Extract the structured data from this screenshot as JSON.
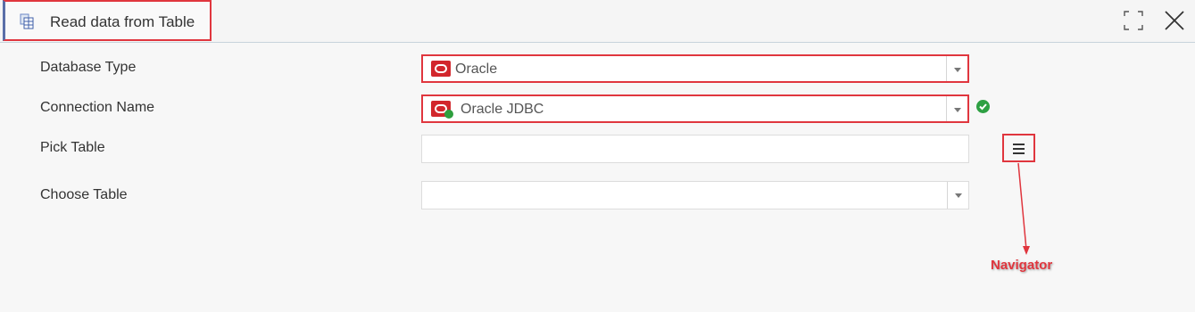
{
  "window": {
    "tab_title": "Read data from Table",
    "tab_icon": "table-icon",
    "expand_icon": "expand-icon",
    "close_icon": "close-icon"
  },
  "form": {
    "database_type": {
      "label": "Database Type",
      "value": "Oracle",
      "icon": "oracle-logo-icon"
    },
    "connection_name": {
      "label": "Connection Name",
      "value": "Oracle JDBC",
      "icon": "oracle-connection-icon",
      "status_icon": "check-circle-icon"
    },
    "pick_table": {
      "label": "Pick Table",
      "value": "",
      "navigator_icon": "hamburger-menu-icon"
    },
    "choose_table": {
      "label": "Choose Table",
      "value": ""
    }
  },
  "annotation": {
    "navigator_label": "Navigator"
  },
  "colors": {
    "highlight": "#e0363e",
    "oracle_red": "#d2262c",
    "success_green": "#2ea043",
    "background": "#f7f7f7"
  }
}
